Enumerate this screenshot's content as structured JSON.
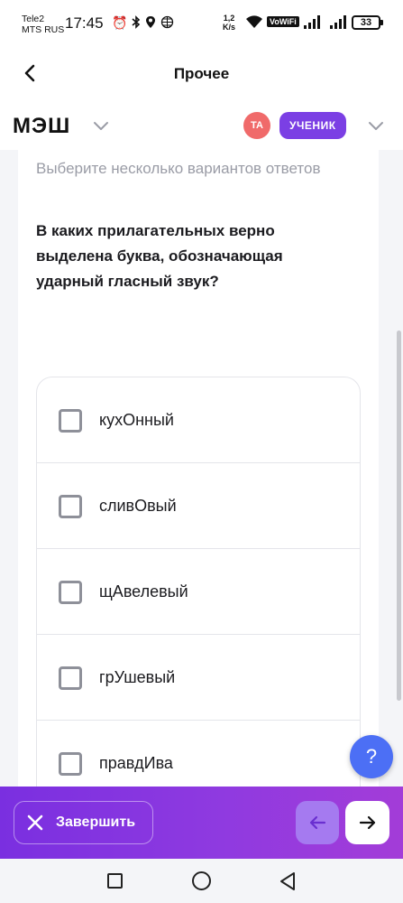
{
  "status_bar": {
    "carrier_1": "Tele2",
    "carrier_2": "MTS RUS",
    "time": "17:45",
    "net_speed_value": "1,2",
    "net_speed_unit": "K/s",
    "vowifi": "VoWiFi",
    "battery": "33"
  },
  "header": {
    "title": "Прочее",
    "back_icon": "arrow-left-icon"
  },
  "brand": {
    "logo": "МЭШ",
    "avatar_initials": "ТА",
    "role": "УЧЕНИК"
  },
  "question": {
    "hint": "Выберите несколько вариантов ответов",
    "text": "В каких прилагательных верно выделена буква, обозначающая ударный гласный звук?",
    "options": [
      {
        "label": "кухОнный",
        "checked": false
      },
      {
        "label": "сливОвый",
        "checked": false
      },
      {
        "label": "щАвелевый",
        "checked": false
      },
      {
        "label": "грУшевый",
        "checked": false
      },
      {
        "label": "правдИва",
        "checked": false
      }
    ]
  },
  "help": {
    "label": "?"
  },
  "actions": {
    "finish_label": "Завершить",
    "prev_icon": "arrow-left-icon",
    "next_icon": "arrow-right-icon"
  },
  "colors": {
    "accent": "#7b3fe4",
    "help": "#4c6ff5",
    "avatar": "#f06a6a"
  }
}
